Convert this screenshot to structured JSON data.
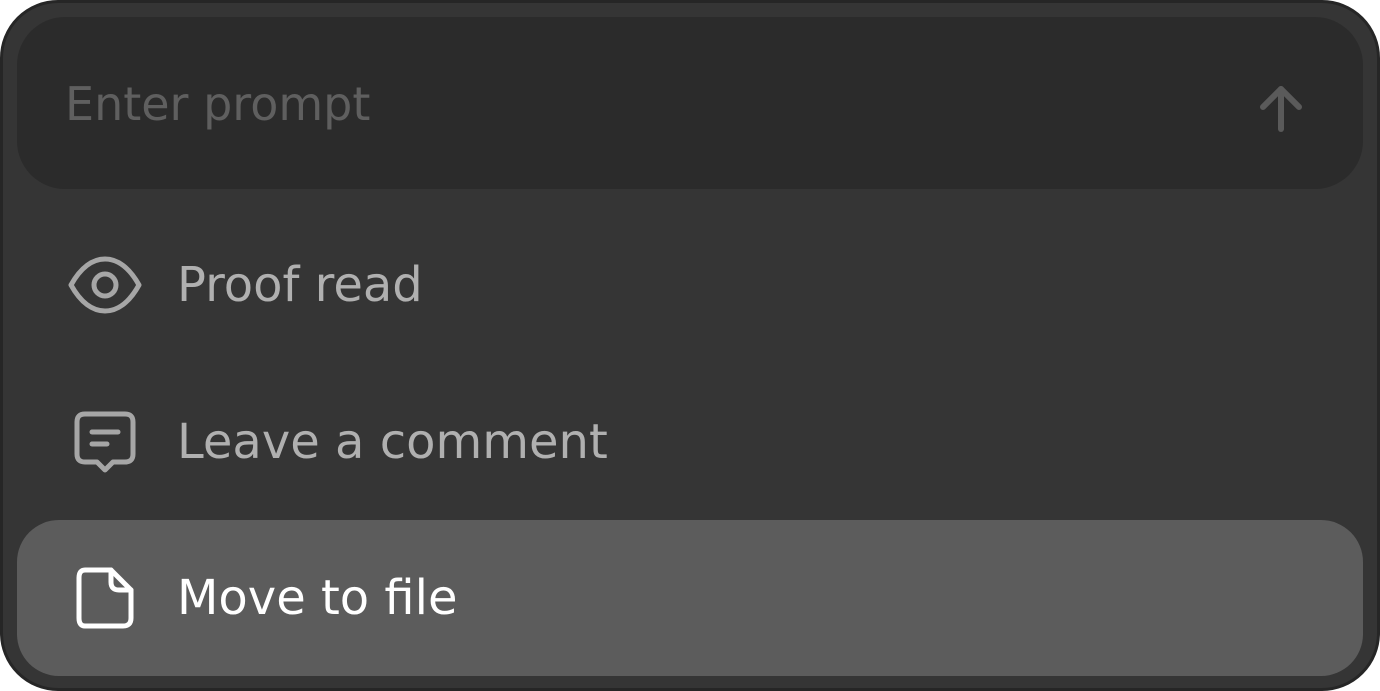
{
  "prompt": {
    "placeholder": "Enter prompt",
    "value": "",
    "submit_icon": "arrow-up-icon"
  },
  "menu": {
    "items": [
      {
        "label": "Proof read",
        "icon": "eye-icon",
        "selected": false
      },
      {
        "label": "Leave a comment",
        "icon": "comment-icon",
        "selected": false
      },
      {
        "label": "Move to file",
        "icon": "file-icon",
        "selected": true
      }
    ]
  },
  "colors": {
    "panel_background": "#353535",
    "prompt_background": "#2b2b2b",
    "selected_item_background": "#5c5c5c",
    "item_text": "#b0b0b0",
    "selected_item_text": "#ffffff",
    "placeholder_text": "#5f5f5f"
  }
}
